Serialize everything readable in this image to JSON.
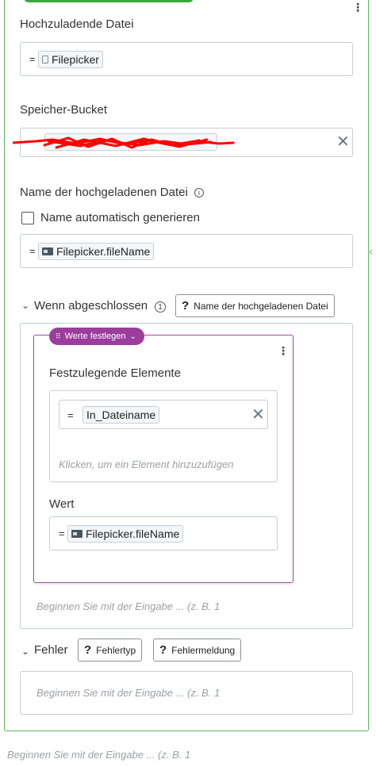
{
  "upload_file": {
    "label": "Hochzuladende Datei",
    "operator": "=",
    "chip": "Filepicker"
  },
  "storage_bucket": {
    "label": "Speicher-Bucket"
  },
  "uploaded_name": {
    "label": "Name der hochgeladenen Datei",
    "auto_generate_label": "Name automatisch generieren",
    "operator": "=",
    "chip": "Filepicker.fileName"
  },
  "on_complete": {
    "label": "Wenn abgeschlossen",
    "count": "1",
    "param_chip": "Name der hochgeladenen Datei",
    "set_values": {
      "tag": "Werte festlegen",
      "elements_label": "Festzulegende Elemente",
      "element": {
        "operator": "=",
        "chip": "In_Dateiname"
      },
      "add_element_hint": "Klicken, um ein Element hinzuzufügen",
      "value_label": "Wert",
      "value": {
        "operator": "=",
        "chip": "Filepicker.fileName"
      }
    },
    "input_placeholder": "Beginnen Sie mit der Eingabe ... (z. B. 1"
  },
  "error": {
    "label": "Fehler",
    "chips": [
      "Fehlertyp",
      "Fehlermeldung"
    ],
    "input_placeholder": "Beginnen Sie mit der Eingabe ... (z. B. 1"
  },
  "bottom_placeholder": "Beginnen Sie mit der Eingabe ... (z. B. 1",
  "colors": {
    "panel_border": "#5cb85c",
    "accent_purple": "#9a3d9c",
    "redaction": "#ff0000"
  }
}
